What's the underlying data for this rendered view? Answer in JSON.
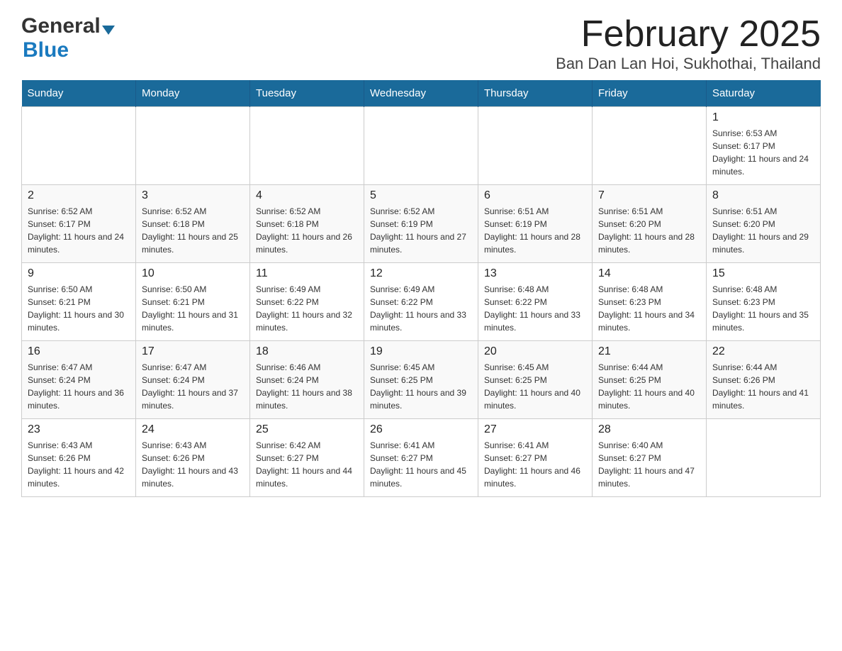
{
  "header": {
    "logo_general": "General",
    "logo_blue": "Blue",
    "title": "February 2025",
    "subtitle": "Ban Dan Lan Hoi, Sukhothai, Thailand"
  },
  "days_of_week": [
    "Sunday",
    "Monday",
    "Tuesday",
    "Wednesday",
    "Thursday",
    "Friday",
    "Saturday"
  ],
  "weeks": [
    [
      {
        "day": "",
        "info": ""
      },
      {
        "day": "",
        "info": ""
      },
      {
        "day": "",
        "info": ""
      },
      {
        "day": "",
        "info": ""
      },
      {
        "day": "",
        "info": ""
      },
      {
        "day": "",
        "info": ""
      },
      {
        "day": "1",
        "info": "Sunrise: 6:53 AM\nSunset: 6:17 PM\nDaylight: 11 hours and 24 minutes."
      }
    ],
    [
      {
        "day": "2",
        "info": "Sunrise: 6:52 AM\nSunset: 6:17 PM\nDaylight: 11 hours and 24 minutes."
      },
      {
        "day": "3",
        "info": "Sunrise: 6:52 AM\nSunset: 6:18 PM\nDaylight: 11 hours and 25 minutes."
      },
      {
        "day": "4",
        "info": "Sunrise: 6:52 AM\nSunset: 6:18 PM\nDaylight: 11 hours and 26 minutes."
      },
      {
        "day": "5",
        "info": "Sunrise: 6:52 AM\nSunset: 6:19 PM\nDaylight: 11 hours and 27 minutes."
      },
      {
        "day": "6",
        "info": "Sunrise: 6:51 AM\nSunset: 6:19 PM\nDaylight: 11 hours and 28 minutes."
      },
      {
        "day": "7",
        "info": "Sunrise: 6:51 AM\nSunset: 6:20 PM\nDaylight: 11 hours and 28 minutes."
      },
      {
        "day": "8",
        "info": "Sunrise: 6:51 AM\nSunset: 6:20 PM\nDaylight: 11 hours and 29 minutes."
      }
    ],
    [
      {
        "day": "9",
        "info": "Sunrise: 6:50 AM\nSunset: 6:21 PM\nDaylight: 11 hours and 30 minutes."
      },
      {
        "day": "10",
        "info": "Sunrise: 6:50 AM\nSunset: 6:21 PM\nDaylight: 11 hours and 31 minutes."
      },
      {
        "day": "11",
        "info": "Sunrise: 6:49 AM\nSunset: 6:22 PM\nDaylight: 11 hours and 32 minutes."
      },
      {
        "day": "12",
        "info": "Sunrise: 6:49 AM\nSunset: 6:22 PM\nDaylight: 11 hours and 33 minutes."
      },
      {
        "day": "13",
        "info": "Sunrise: 6:48 AM\nSunset: 6:22 PM\nDaylight: 11 hours and 33 minutes."
      },
      {
        "day": "14",
        "info": "Sunrise: 6:48 AM\nSunset: 6:23 PM\nDaylight: 11 hours and 34 minutes."
      },
      {
        "day": "15",
        "info": "Sunrise: 6:48 AM\nSunset: 6:23 PM\nDaylight: 11 hours and 35 minutes."
      }
    ],
    [
      {
        "day": "16",
        "info": "Sunrise: 6:47 AM\nSunset: 6:24 PM\nDaylight: 11 hours and 36 minutes."
      },
      {
        "day": "17",
        "info": "Sunrise: 6:47 AM\nSunset: 6:24 PM\nDaylight: 11 hours and 37 minutes."
      },
      {
        "day": "18",
        "info": "Sunrise: 6:46 AM\nSunset: 6:24 PM\nDaylight: 11 hours and 38 minutes."
      },
      {
        "day": "19",
        "info": "Sunrise: 6:45 AM\nSunset: 6:25 PM\nDaylight: 11 hours and 39 minutes."
      },
      {
        "day": "20",
        "info": "Sunrise: 6:45 AM\nSunset: 6:25 PM\nDaylight: 11 hours and 40 minutes."
      },
      {
        "day": "21",
        "info": "Sunrise: 6:44 AM\nSunset: 6:25 PM\nDaylight: 11 hours and 40 minutes."
      },
      {
        "day": "22",
        "info": "Sunrise: 6:44 AM\nSunset: 6:26 PM\nDaylight: 11 hours and 41 minutes."
      }
    ],
    [
      {
        "day": "23",
        "info": "Sunrise: 6:43 AM\nSunset: 6:26 PM\nDaylight: 11 hours and 42 minutes."
      },
      {
        "day": "24",
        "info": "Sunrise: 6:43 AM\nSunset: 6:26 PM\nDaylight: 11 hours and 43 minutes."
      },
      {
        "day": "25",
        "info": "Sunrise: 6:42 AM\nSunset: 6:27 PM\nDaylight: 11 hours and 44 minutes."
      },
      {
        "day": "26",
        "info": "Sunrise: 6:41 AM\nSunset: 6:27 PM\nDaylight: 11 hours and 45 minutes."
      },
      {
        "day": "27",
        "info": "Sunrise: 6:41 AM\nSunset: 6:27 PM\nDaylight: 11 hours and 46 minutes."
      },
      {
        "day": "28",
        "info": "Sunrise: 6:40 AM\nSunset: 6:27 PM\nDaylight: 11 hours and 47 minutes."
      },
      {
        "day": "",
        "info": ""
      }
    ]
  ]
}
